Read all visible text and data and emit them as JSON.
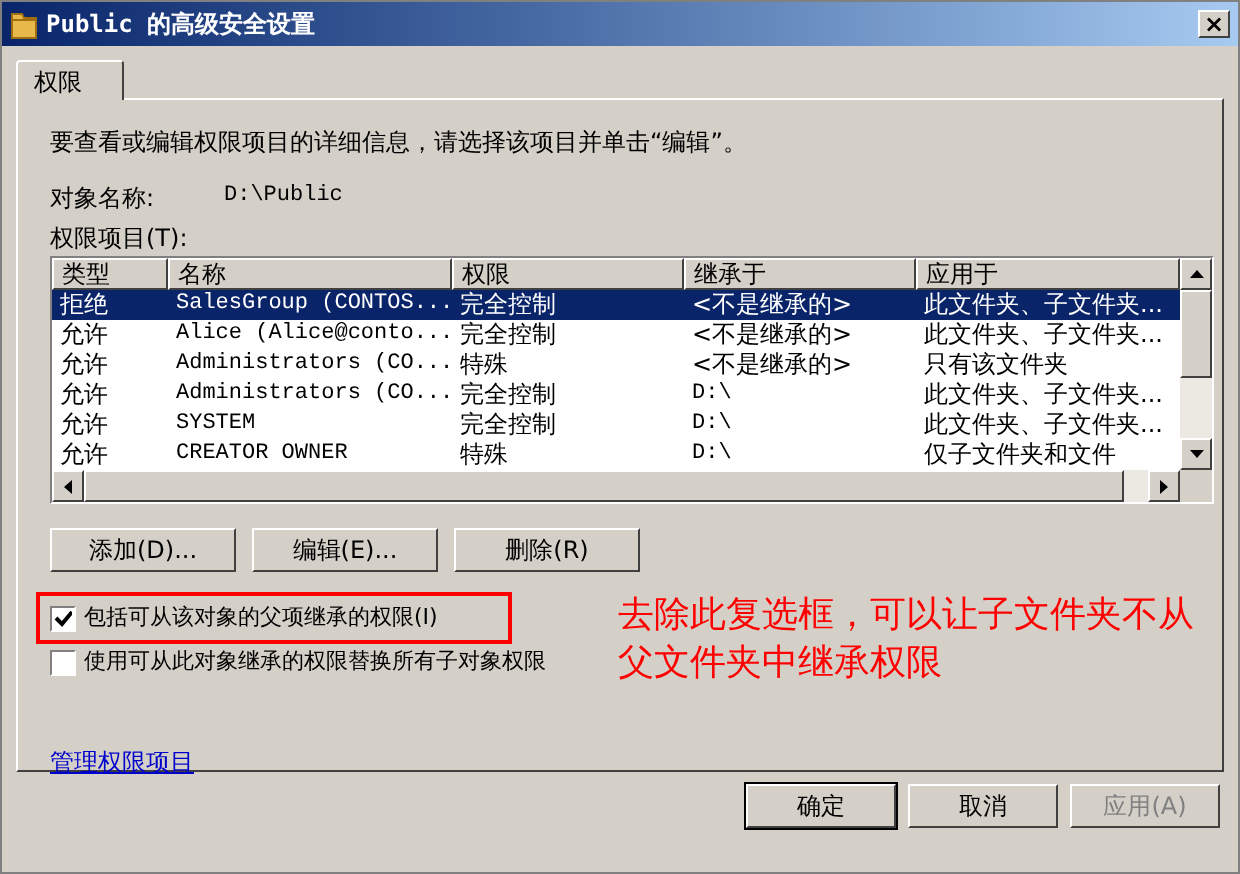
{
  "window": {
    "title": "Public 的高级安全设置",
    "close": "×"
  },
  "tabs": [
    {
      "label": "权限",
      "selected": true
    }
  ],
  "description": "要查看或编辑权限项目的详细信息，请选择该项目并单击“编辑”。",
  "object_name": {
    "label": "对象名称:",
    "value": "D:\\Public"
  },
  "entries": {
    "label": "权限项目(T):",
    "columns": [
      "类型",
      "名称",
      "权限",
      "继承于",
      "应用于"
    ],
    "rows": [
      {
        "cells": [
          "拒绝",
          "SalesGroup (CONTOS...",
          "完全控制",
          "<不是继承的>",
          "此文件夹、子文件夹..."
        ],
        "selected": true
      },
      {
        "cells": [
          "允许",
          "Alice (Alice@conto...",
          "完全控制",
          "<不是继承的>",
          "此文件夹、子文件夹..."
        ],
        "selected": false
      },
      {
        "cells": [
          "允许",
          "Administrators (CO...",
          "特殊",
          "<不是继承的>",
          "只有该文件夹"
        ],
        "selected": false
      },
      {
        "cells": [
          "允许",
          "Administrators (CO...",
          "完全控制",
          "D:\\",
          "此文件夹、子文件夹..."
        ],
        "selected": false
      },
      {
        "cells": [
          "允许",
          "SYSTEM",
          "完全控制",
          "D:\\",
          "此文件夹、子文件夹..."
        ],
        "selected": false
      },
      {
        "cells": [
          "允许",
          "CREATOR OWNER",
          "特殊",
          "D:\\",
          "仅子文件夹和文件"
        ],
        "selected": false
      }
    ]
  },
  "buttons": [
    "添加(D)...",
    "编辑(E)...",
    "删除(R)"
  ],
  "checkboxes": [
    {
      "label": "包括可从该对象的父项继承的权限(I)",
      "checked": true,
      "highlighted": true
    },
    {
      "label": "使用可从此对象继承的权限替换所有子对象权限",
      "checked": false,
      "highlighted": false
    }
  ],
  "annotation": "去除此复选框，可以让子文件夹不从父文件夹中继承权限",
  "link": "管理权限项目",
  "dialog_buttons": [
    {
      "label": "确定",
      "default": true,
      "disabled": false
    },
    {
      "label": "取消",
      "default": false,
      "disabled": false
    },
    {
      "label": "应用(A)",
      "default": false,
      "disabled": true
    }
  ]
}
